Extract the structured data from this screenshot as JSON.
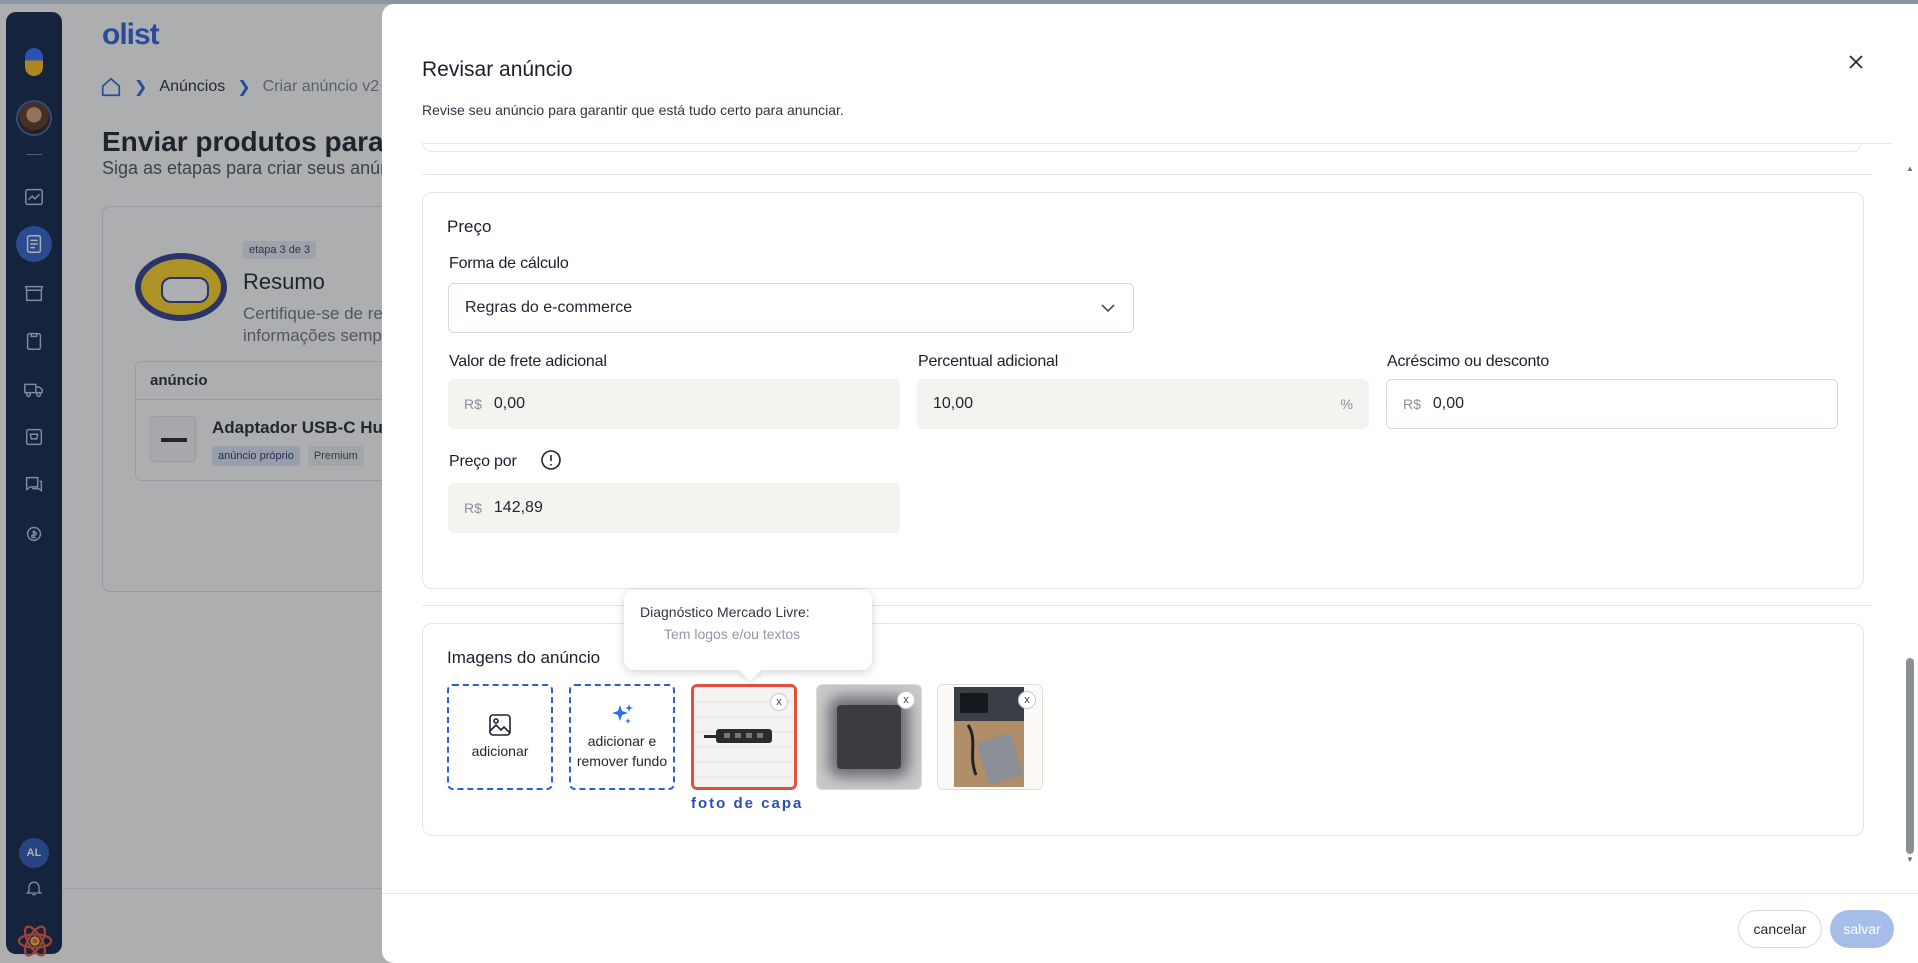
{
  "colors": {
    "accent": "#2b5fd9",
    "sidebar": "#0b1f45",
    "cover_border": "#e0503a",
    "save_disabled": "#a7bde9"
  },
  "background": {
    "brand": "olist",
    "breadcrumb": {
      "home_icon": "home-icon",
      "items": [
        "Anúncios",
        "Criar anúncio v2"
      ]
    },
    "title": "Enviar produtos para o Mercado Livre",
    "subtitle": "Siga as etapas para criar seus anúncios",
    "step": {
      "badge": "etapa 3 de 3",
      "title": "Resumo",
      "desc_line1": "Certifique-se de revisar as",
      "desc_line2": "informações sempre"
    },
    "table": {
      "header": "anúncio",
      "product": "Adaptador USB-C Hub",
      "tags": [
        "anúncio próprio",
        "Premium"
      ]
    }
  },
  "sidebar": {
    "user_initials": "AL"
  },
  "drawer": {
    "title": "Revisar anúncio",
    "subtitle": "Revise seu anúncio para garantir que está tudo certo para anunciar.",
    "price": {
      "section_title": "Preço",
      "calc_label": "Forma de cálculo",
      "calc_value": "Regras do e-commerce",
      "freight_label": "Valor de frete adicional",
      "freight_prefix": "R$",
      "freight_value": "0,00",
      "percent_label": "Percentual adicional",
      "percent_value": "10,00",
      "percent_suffix": "%",
      "adjust_label": "Acréscimo ou desconto",
      "adjust_prefix": "R$",
      "adjust_value": "0,00",
      "final_label": "Preço por",
      "final_prefix": "R$",
      "final_value": "142,89"
    },
    "images": {
      "section_title": "Imagens do anúncio",
      "add_label": "adicionar",
      "add_remove_bg_label_1": "adicionar e",
      "add_remove_bg_label_2": "remover fundo",
      "cover_label": "foto de capa",
      "remove_glyph": "x",
      "tooltip_title": "Diagnóstico Mercado Livre:",
      "tooltip_text": "Tem logos e/ou textos"
    },
    "footer": {
      "cancel": "cancelar",
      "save": "salvar"
    }
  }
}
